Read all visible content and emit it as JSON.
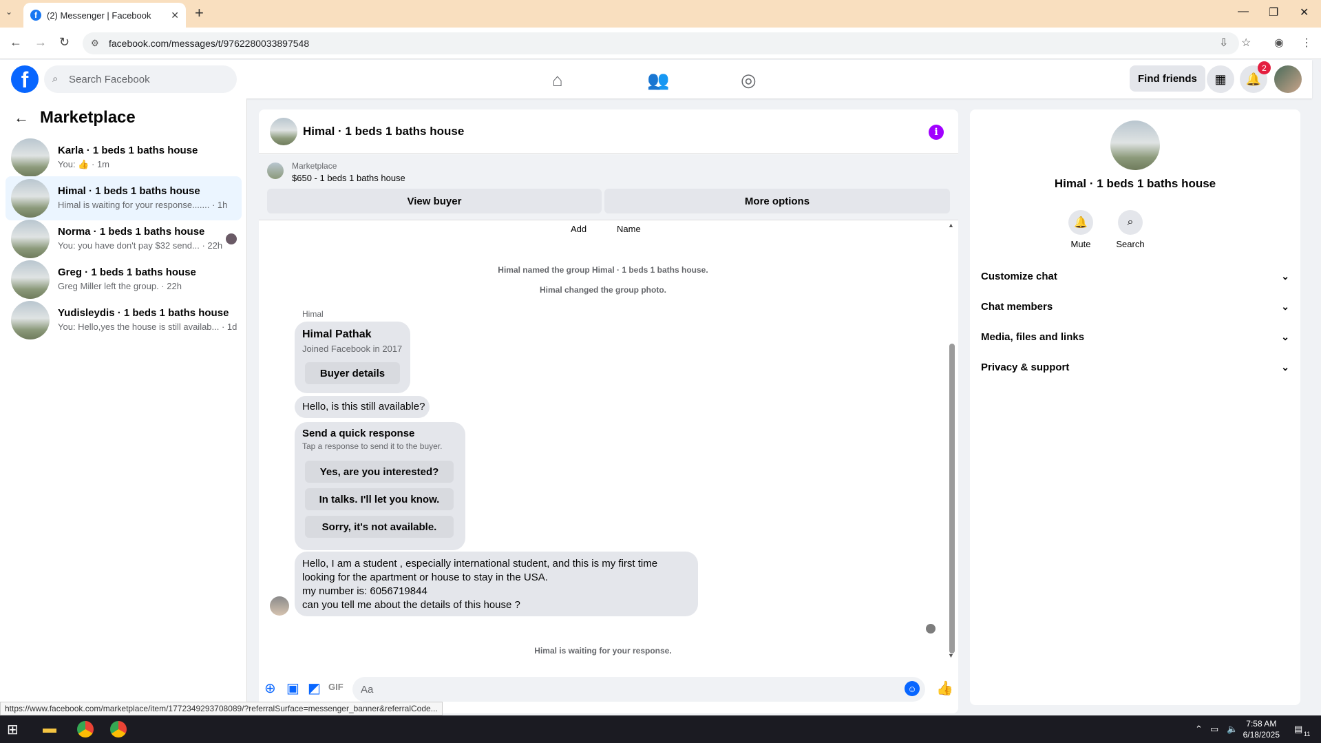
{
  "browser": {
    "tab_title": "(2) Messenger | Facebook",
    "url": "facebook.com/messages/t/9762280033897548",
    "status_url": "https://www.facebook.com/marketplace/item/1772349293708089/?referralSurface=messenger_banner&referralCode..."
  },
  "header": {
    "search_placeholder": "Search Facebook",
    "find_friends": "Find friends",
    "notification_count": "2"
  },
  "sidebar": {
    "title": "Marketplace",
    "conversations": [
      {
        "name": "Karla · 1 beds 1 baths house",
        "sub_prefix": "You:",
        "sub_suffix": "· 1m"
      },
      {
        "name": "Himal · 1 beds 1 baths house",
        "sub": "Himal is waiting for your response....... · 1h"
      },
      {
        "name": "Norma · 1 beds 1 baths house",
        "sub": "You: you have don't pay $32 send... · 22h"
      },
      {
        "name": "Greg · 1 beds 1 baths house",
        "sub": "Greg Miller left the group. · 22h"
      },
      {
        "name": "Yudisleydis · 1 beds 1 baths house",
        "sub": "You: Hello,yes the house is still availab... · 1d"
      }
    ]
  },
  "chat": {
    "title": "Himal · 1 beds 1 baths house",
    "banner_label": "Marketplace",
    "banner_listing": "$650 - 1 beds 1 baths house",
    "view_buyer": "View buyer",
    "more_options": "More options",
    "add_label": "Add",
    "name_label": "Name",
    "system_1": "Himal named the group Himal · 1 beds 1 baths house.",
    "system_2": "Himal changed the group photo.",
    "sender": "Himal",
    "profile_name": "Himal Pathak",
    "profile_joined": "Joined Facebook in 2017",
    "buyer_details": "Buyer details",
    "msg_available": "Hello, is this still available?",
    "quick_title": "Send a quick response",
    "quick_sub": "Tap a response to send it to the buyer.",
    "quick_1": "Yes, are you interested?",
    "quick_2": "In talks. I'll let you know.",
    "quick_3": "Sorry, it's not available.",
    "long_msg_lines": [
      "Hello, I am a student , especially international student, and this is my first time",
      "looking for the apartment or house to stay in the USA.",
      "my number is: 6056719844",
      "can you tell me about the details of this house ?"
    ],
    "waiting": "Himal is waiting for your response.",
    "composer_placeholder": "Aa"
  },
  "details": {
    "title": "Himal · 1 beds 1 baths house",
    "mute": "Mute",
    "search": "Search",
    "sections": [
      "Customize chat",
      "Chat members",
      "Media, files and links",
      "Privacy & support"
    ]
  },
  "taskbar": {
    "time": "7:58 AM",
    "date": "6/18/2025",
    "notif": "11"
  }
}
